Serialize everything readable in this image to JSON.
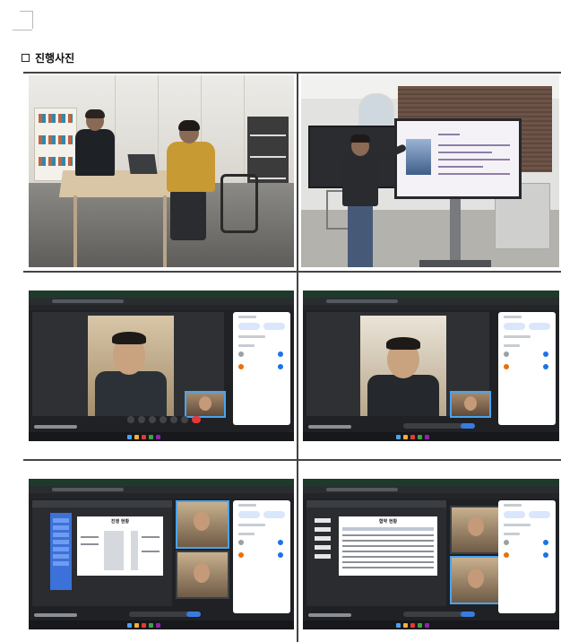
{
  "section": {
    "heading": "진행사진"
  },
  "photos": {
    "slide_title_1": "진행 현황",
    "slide_title_2": "협약 현황"
  }
}
